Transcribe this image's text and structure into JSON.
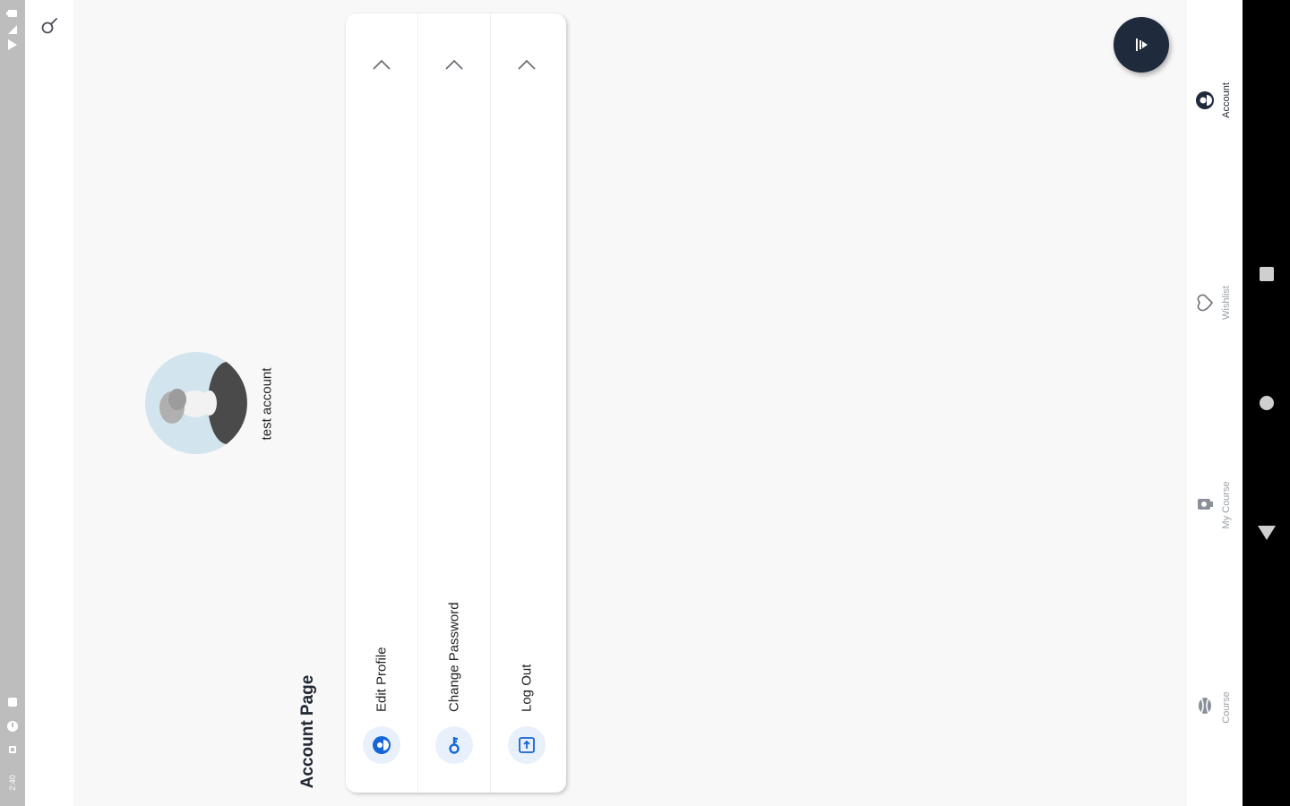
{
  "status_bar": {
    "time": "2:40",
    "icons": [
      "wifi-icon",
      "signal-icon",
      "battery-icon",
      "sim-icon",
      "clock-icon",
      "notification-icon",
      "sd-card-icon"
    ]
  },
  "toolbar": {
    "search_icon": "search-icon"
  },
  "profile": {
    "username": "test account",
    "avatar": "avatar-icon"
  },
  "page": {
    "title": "Account Page"
  },
  "menu": {
    "items": [
      {
        "label": "Edit Profile",
        "icon": "user-circle-icon"
      },
      {
        "label": "Change Password",
        "icon": "key-icon"
      },
      {
        "label": "Log Out",
        "icon": "logout-icon"
      }
    ],
    "chevron": "chevron-up-icon"
  },
  "fab": {
    "icon": "audio-play-icon"
  },
  "bottom_nav": {
    "items": [
      {
        "label": "Account",
        "icon": "account-icon",
        "active": true
      },
      {
        "label": "Wishlist",
        "icon": "heart-icon",
        "active": false
      },
      {
        "label": "My Course",
        "icon": "my-course-icon",
        "active": false
      },
      {
        "label": "Course",
        "icon": "course-icon",
        "active": false
      }
    ]
  },
  "system_nav": {
    "buttons": [
      "recents-button",
      "home-button",
      "back-button"
    ]
  },
  "colors": {
    "accent": "#1565d8",
    "dark": "#1f2a3c",
    "icon_bg": "#e8f0fb",
    "inactive": "#9aa0a6",
    "status_bar": "#bdbdbd",
    "background": "#f8f8f8"
  }
}
